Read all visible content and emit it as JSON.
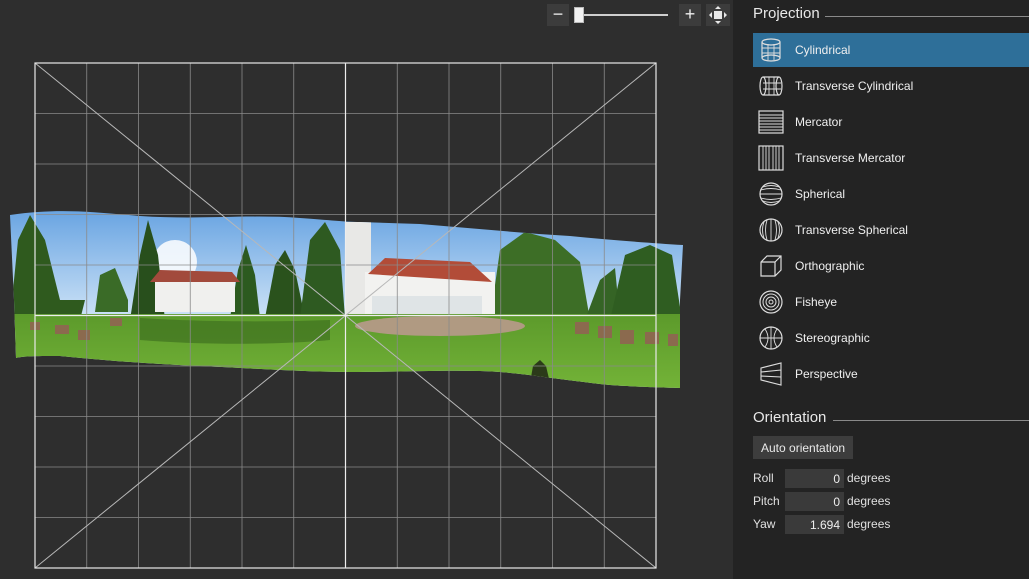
{
  "canvas": {
    "zoom": {
      "zoom_out_glyph": "−",
      "zoom_in_glyph": "+",
      "zoom_out_icon": "minus-icon",
      "zoom_in_icon": "plus-icon",
      "fit_icon": "fit-to-window-icon"
    },
    "preview": "panorama-preview"
  },
  "projection": {
    "title": "Projection",
    "selected": "Cylindrical",
    "items": [
      {
        "label": "Cylindrical",
        "icon": "cylindrical-icon"
      },
      {
        "label": "Transverse Cylindrical",
        "icon": "transverse-cylindrical-icon"
      },
      {
        "label": "Mercator",
        "icon": "mercator-icon"
      },
      {
        "label": "Transverse Mercator",
        "icon": "transverse-mercator-icon"
      },
      {
        "label": "Spherical",
        "icon": "spherical-icon"
      },
      {
        "label": "Transverse Spherical",
        "icon": "transverse-spherical-icon"
      },
      {
        "label": "Orthographic",
        "icon": "orthographic-icon"
      },
      {
        "label": "Fisheye",
        "icon": "fisheye-icon"
      },
      {
        "label": "Stereographic",
        "icon": "stereographic-icon"
      },
      {
        "label": "Perspective",
        "icon": "perspective-icon"
      }
    ]
  },
  "orientation": {
    "title": "Orientation",
    "auto_button": "Auto orientation",
    "roll": {
      "label": "Roll",
      "value": "0",
      "unit": "degrees"
    },
    "pitch": {
      "label": "Pitch",
      "value": "0",
      "unit": "degrees"
    },
    "yaw": {
      "label": "Yaw",
      "value": "1.694",
      "unit": "degrees"
    }
  },
  "colors": {
    "selection": "#2e6f99",
    "panel_bg": "#232323",
    "canvas_bg": "#2e2e2e"
  }
}
